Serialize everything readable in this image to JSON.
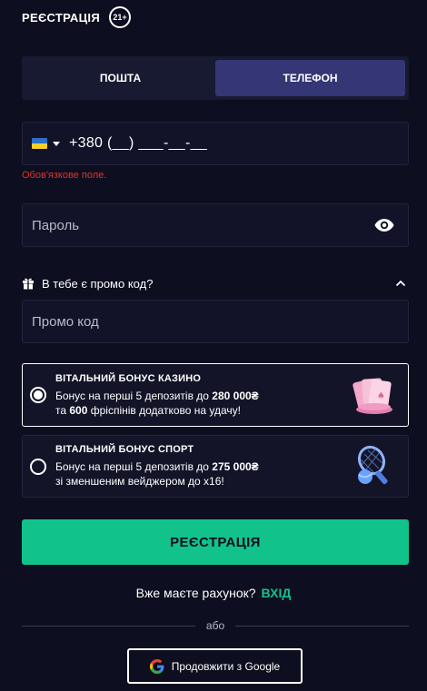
{
  "header": {
    "title": "РЕЄСТРАЦІЯ",
    "age_badge": "21+"
  },
  "tabs": [
    {
      "label": "ПОШТА",
      "active": false
    },
    {
      "label": "ТЕЛЕФОН",
      "active": true
    }
  ],
  "phone": {
    "value": "+380 (__) ___-__-__",
    "error": "Обов'язкове поле."
  },
  "password": {
    "placeholder": "Пароль"
  },
  "promo": {
    "question": "В тебе є промо код?",
    "placeholder": "Промо код"
  },
  "bonuses": [
    {
      "title": "ВІТАЛЬНИЙ БОНУС КАЗИНО",
      "line1_prefix": "Бонус на перші 5 депозитів до ",
      "line1_amount": "280 000₴",
      "line2_amount": "600",
      "line2_suffix": " фріспінів додатково на удачу!",
      "selected": true
    },
    {
      "title": "ВІТАЛЬНИЙ БОНУС СПОРТ",
      "line1_prefix": "Бонус на перші 5 депозитів до ",
      "line1_amount": "275 000₴",
      "line2_text": "зі зменшеним вейджером до x16!",
      "selected": false
    }
  ],
  "register_button": "РЕЄСТРАЦІЯ",
  "login": {
    "question": "Вже маєте рахунок?",
    "link": "ВХІД"
  },
  "divider": "або",
  "google_button": "Продовжити з Google",
  "colors": {
    "accent": "#11c38b",
    "active_tab": "#353675",
    "error": "#e0332f",
    "background": "#0d0e1f"
  }
}
